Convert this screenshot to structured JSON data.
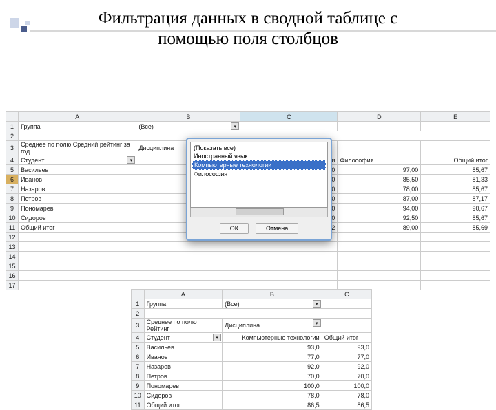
{
  "title_line1": "Фильтрация данных в сводной таблице с",
  "title_line2": "помощью поля столбцов",
  "sheet1": {
    "cols": [
      "A",
      "B",
      "C",
      "D",
      "E"
    ],
    "r1": {
      "a": "Группа",
      "b": "(Все)"
    },
    "r3": {
      "a": "Среднее по полю Средний рейтинг за год",
      "b": "Дисциплина"
    },
    "r4": {
      "a": "Студент",
      "c": "Компьютерные технологии",
      "d": "Философия",
      "e": "Общий итог"
    },
    "rows": [
      {
        "n": "5",
        "a": "Васильев",
        "c": "95,50",
        "d": "97,00",
        "e": "85,67"
      },
      {
        "n": "6",
        "a": "Иванов",
        "c": "77,50",
        "d": "85,50",
        "e": "81,33"
      },
      {
        "n": "7",
        "a": "Назаров",
        "c": "91,00",
        "d": "78,00",
        "e": "85,67"
      },
      {
        "n": "8",
        "a": "Петров",
        "c": "84,50",
        "d": "87,00",
        "e": "87,17"
      },
      {
        "n": "9",
        "a": "Пономарев",
        "c": "94,50",
        "d": "94,00",
        "e": "90,67"
      },
      {
        "n": "10",
        "a": "Сидоров",
        "c": "78,00",
        "d": "92,50",
        "e": "85,67"
      },
      {
        "n": "11",
        "a": "Общий итог",
        "c": "86,92",
        "d": "89,00",
        "e": "85,69"
      }
    ],
    "blank": [
      "12",
      "13",
      "14",
      "15",
      "16",
      "17"
    ]
  },
  "filter": {
    "items": [
      "(Показать все)",
      "Иностранный язык",
      "Компьютерные технологии",
      "Философия"
    ],
    "selected_index": 2,
    "ok": "ОК",
    "cancel": "Отмена"
  },
  "sheet2": {
    "cols": [
      "A",
      "B",
      "C"
    ],
    "r1": {
      "a": "Группа",
      "b": "(Все)"
    },
    "r3": {
      "a": "Среднее по полю Рейтинг",
      "b": "Дисциплина"
    },
    "r4": {
      "a": "Студент",
      "b": "Компьютерные технологии",
      "c": "Общий итог"
    },
    "rows": [
      {
        "n": "5",
        "a": "Васильев",
        "b": "93,0",
        "c": "93,0"
      },
      {
        "n": "6",
        "a": "Иванов",
        "b": "77,0",
        "c": "77,0"
      },
      {
        "n": "7",
        "a": "Назаров",
        "b": "92,0",
        "c": "92,0"
      },
      {
        "n": "8",
        "a": "Петров",
        "b": "70,0",
        "c": "70,0"
      },
      {
        "n": "9",
        "a": "Пономарев",
        "b": "100,0",
        "c": "100,0"
      },
      {
        "n": "10",
        "a": "Сидоров",
        "b": "78,0",
        "c": "78,0"
      },
      {
        "n": "11",
        "a": "Общий итог",
        "b": "86,5",
        "c": "86,5"
      }
    ]
  }
}
